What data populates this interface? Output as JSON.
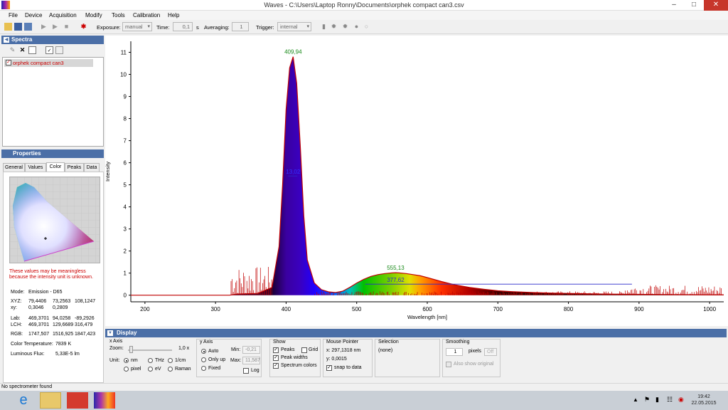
{
  "window": {
    "title": "Waves  -  C:\\Users\\Laptop Ronny\\Documents\\orphek compact can3.csv",
    "minimize": "–",
    "maximize": "□",
    "close": "✕"
  },
  "menu": [
    "File",
    "Device",
    "Acquisition",
    "Modify",
    "Tools",
    "Calibration",
    "Help"
  ],
  "toolbar": {
    "exposure_label": "Exposure:",
    "exposure_value": "manual",
    "time_label": "Time:",
    "time_value": "0,1",
    "time_unit": "s",
    "averaging_label": "Averaging:",
    "averaging_value": "1",
    "trigger_label": "Trigger:",
    "trigger_value": "internal"
  },
  "spectra_panel": {
    "title": "Spectra",
    "items": [
      {
        "label": "orphek compact can3",
        "checked": true,
        "color": "#cc0000"
      }
    ]
  },
  "properties_panel": {
    "title": "Properties",
    "tabs": [
      "General",
      "Values",
      "Color",
      "Peaks",
      "Data"
    ],
    "active_tab": "Color",
    "warning_line1": "These values may be meaningless",
    "warning_line2": "because the intensity unit is unknown.",
    "mode_label": "Mode:",
    "mode_value": "Emission - D65",
    "xyz_label": "XYZ:",
    "xyz": [
      "79,4406",
      "73,2563",
      "108,1247"
    ],
    "xy_label": "xy:",
    "xy": [
      "0,3046",
      "0,2809"
    ],
    "lab_label": "Lab:",
    "lab": [
      "469,3701",
      "94,0258",
      "-89,2926"
    ],
    "lch_label": "LCH:",
    "lch": [
      "469,3701",
      "129,6689",
      "316,479"
    ],
    "rgb_label": "RGB:",
    "rgb": [
      "1747,507",
      "1516,925",
      "1847,423"
    ],
    "ct_label": "Color Temperature:",
    "ct_value": "7839 K",
    "lf_label": "Luminous Flux:",
    "lf_value": "5,33E-5 lm"
  },
  "chart_data": {
    "type": "line",
    "xlabel": "Wavelength [nm]",
    "ylabel": "Intensity",
    "xlim": [
      180,
      1020
    ],
    "ylim": [
      -0.3,
      11.5
    ],
    "xticks": [
      200,
      300,
      400,
      500,
      600,
      700,
      800,
      900,
      1000
    ],
    "yticks": [
      0,
      1,
      2,
      3,
      4,
      5,
      6,
      7,
      8,
      9,
      10,
      11
    ],
    "series": [
      {
        "x": [
          180,
          320,
          330,
          360,
          380,
          390,
          395,
          400,
          405,
          409.94,
          415,
          420,
          425,
          430,
          440,
          450,
          460,
          470,
          480,
          490,
          500,
          510,
          520,
          530,
          540,
          550,
          555.13,
          560,
          570,
          580,
          590,
          600,
          620,
          640,
          660,
          680,
          700,
          720,
          750,
          780,
          800,
          850,
          900,
          950,
          1000,
          1020
        ],
        "y": [
          0,
          0,
          0.05,
          0.08,
          0.35,
          2.2,
          5.0,
          8.4,
          10.3,
          10.8,
          9.6,
          6.8,
          3.6,
          1.6,
          0.55,
          0.25,
          0.15,
          0.12,
          0.18,
          0.35,
          0.55,
          0.72,
          0.85,
          0.93,
          0.98,
          1.01,
          1.02,
          1.01,
          0.98,
          0.93,
          0.88,
          0.8,
          0.62,
          0.46,
          0.35,
          0.27,
          0.2,
          0.16,
          0.12,
          0.09,
          0.08,
          0.05,
          0.04,
          0.03,
          0.02,
          0.02
        ],
        "color": "#c00000"
      }
    ],
    "peaks": [
      {
        "x": 409.94,
        "y": 10.8,
        "label": "409,94",
        "width_label": "13,02"
      },
      {
        "x": 555.13,
        "y": 1.02,
        "label": "555,13",
        "width_label": "377,62"
      }
    ],
    "peak_width_lines": [
      {
        "y": 5.4,
        "x0": 403,
        "x1": 416
      },
      {
        "y": 0.5,
        "x0": 512,
        "x1": 890
      }
    ]
  },
  "display_panel": {
    "title": "Display",
    "xaxis": {
      "title": "x Axis",
      "zoom_label": "Zoom:",
      "zoom_value": "1,0 x",
      "unit_label": "Unit:",
      "units": [
        "nm",
        "THz",
        "1/cm",
        "pixel",
        "eV",
        "Raman"
      ],
      "selected": "nm"
    },
    "yaxis": {
      "title": "y Axis",
      "modes": [
        "Auto",
        "Only up",
        "Fixed"
      ],
      "selected": "Auto",
      "min_label": "Min:",
      "min_value": "-0,21",
      "max_label": "Max:",
      "max_value": "11,587",
      "log_label": "Log"
    },
    "show": {
      "title": "Show",
      "peaks": "Peaks",
      "grid": "Grid",
      "peak_widths": "Peak widths",
      "spectrum_colors": "Spectrum colors"
    },
    "mouse": {
      "title": "Mouse Pointer",
      "x": "x: 297,1318 nm",
      "y": "y: 0,0015",
      "snap": "snap to data"
    },
    "selection": {
      "title": "Selection",
      "value": "(none)"
    },
    "smoothing": {
      "title": "Smoothing",
      "value": "1",
      "unit": "pixels",
      "off": "Off",
      "also_show": "Also show original"
    }
  },
  "status": "No spectrometer found",
  "taskbar": {
    "time": "19:42",
    "date": "22.05.2015"
  }
}
